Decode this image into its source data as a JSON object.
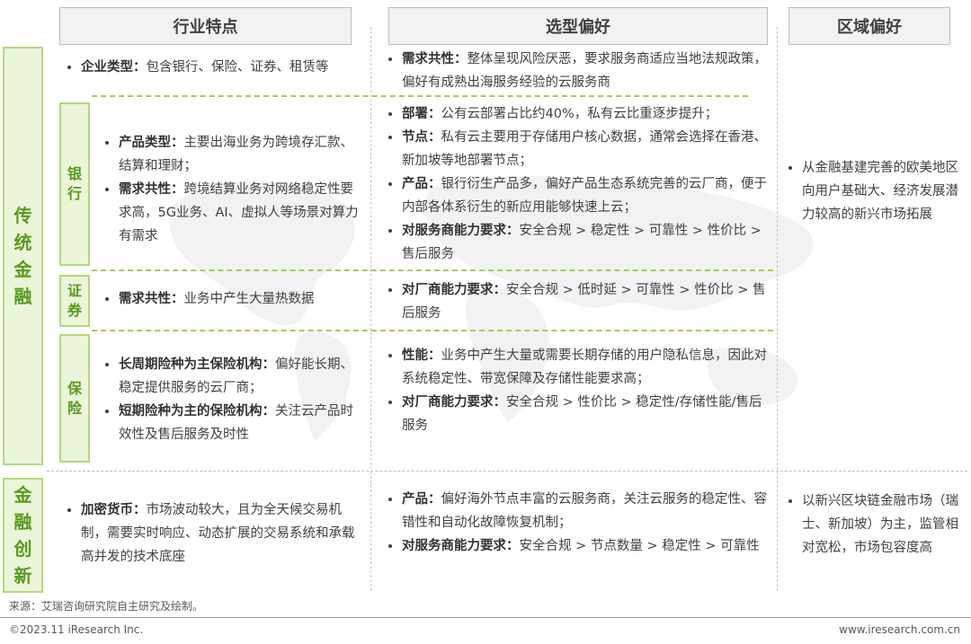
{
  "headers": {
    "industry": "行业特点",
    "preference": "选型偏好",
    "region": "区域偏好"
  },
  "sections": {
    "traditional": "传统金融",
    "innovation": "金融创新"
  },
  "subsections": {
    "bank": "银行",
    "securities": "证券",
    "insurance": "保险"
  },
  "rows": {
    "enterprise": {
      "industry": [
        {
          "key": "企业类型：",
          "text": "包含银行、保险、证券、租赁等"
        }
      ],
      "preference": [
        {
          "key": "需求共性：",
          "text": "整体呈现风险厌恶，要求服务商适应当地法规政策，偏好有成熟出海服务经验的云服务商"
        }
      ]
    },
    "bank": {
      "industry": [
        {
          "key": "产品类型：",
          "text": "主要出海业务为跨境存汇款、结算和理财；"
        },
        {
          "key": "需求共性：",
          "text": "跨境结算业务对网络稳定性要求高，5G业务、AI、虚拟人等场景对算力有需求"
        }
      ],
      "preference": [
        {
          "key": "部署：",
          "text": "公有云部署占比约40%，私有云比重逐步提升；"
        },
        {
          "key": "节点：",
          "text": "私有云主要用于存储用户核心数据，通常会选择在香港、新加坡等地部署节点；"
        },
        {
          "key": "产品：",
          "text": "银行衍生产品多，偏好产品生态系统完善的云厂商，便于内部各体系衍生的新应用能够快速上云；"
        },
        {
          "key": "对服务商能力要求：",
          "text": "安全合规 > 稳定性 > 可靠性 > 性价比 > 售后服务"
        }
      ]
    },
    "securities": {
      "industry": [
        {
          "key": "需求共性：",
          "text": "业务中产生大量热数据"
        }
      ],
      "preference": [
        {
          "key": "对厂商能力要求：",
          "text": "安全合规 > 低时延 > 可靠性 > 性价比 > 售后服务"
        }
      ]
    },
    "insurance": {
      "industry": [
        {
          "key": "长周期险种为主保险机构：",
          "text": "偏好能长期、稳定提供服务的云厂商；"
        },
        {
          "key": "短期险种为主的保险机构：",
          "text": "关注云产品时效性及售后服务及时性"
        }
      ],
      "preference": [
        {
          "key": "性能：",
          "text": "业务中产生大量或需要长期存储的用户隐私信息，因此对系统稳定性、带宽保障及存储性能要求高；"
        },
        {
          "key": "对厂商能力要求：",
          "text": "安全合规 > 性价比 > 稳定性/存储性能/售后服务"
        }
      ]
    },
    "innovation": {
      "industry": [
        {
          "key": "加密货币：",
          "text": "市场波动较大，且为全天候交易机制，需要实时响应、动态扩展的交易系统和承载高并发的技术底座"
        }
      ],
      "preference": [
        {
          "key": "产品：",
          "text": "偏好海外节点丰富的云服务商，关注云服务的稳定性、容错性和自动化故障恢复机制；"
        },
        {
          "key": "对服务商能力要求：",
          "text": "安全合规 > 节点数量 > 稳定性 > 可靠性"
        }
      ]
    }
  },
  "region": {
    "traditional": "从金融基建完善的欧美地区向用户基础大、经济发展潜力较高的新兴市场拓展",
    "innovation": "以新兴区块链金融市场（瑞士、新加坡）为主，监管相对宽松，市场包容度高"
  },
  "footer": {
    "source": "来源：艾瑞咨询研究院自主研究及绘制。",
    "copyright": "©2023.11 iResearch Inc.",
    "website": "www.iresearch.com.cn"
  }
}
